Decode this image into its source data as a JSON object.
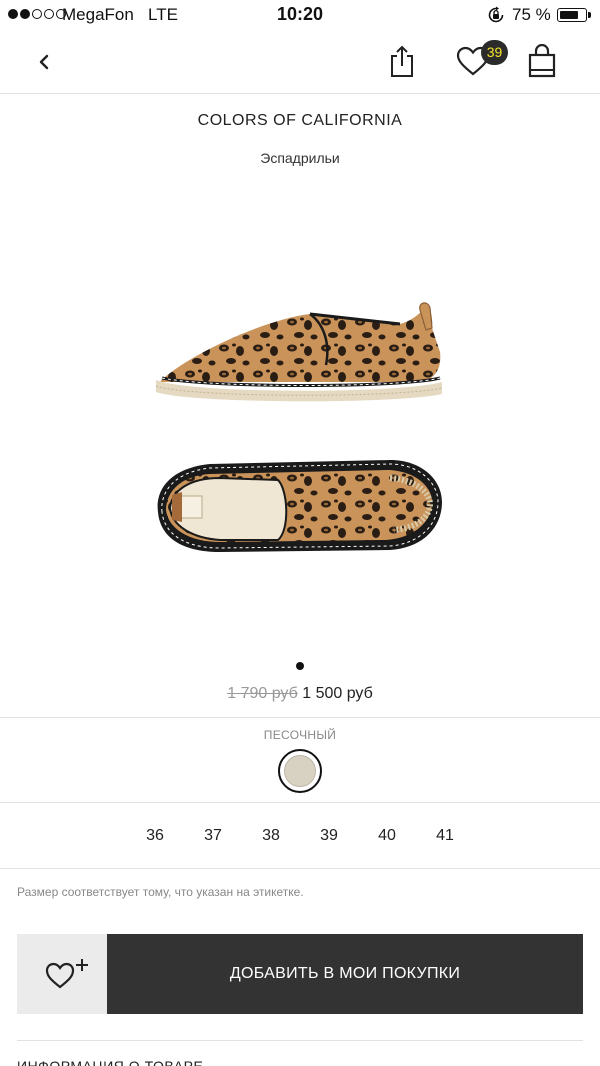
{
  "status_bar": {
    "carrier": "MegaFon",
    "network": "LTE",
    "time": "10:20",
    "battery": "75 %",
    "battery_level": 0.75,
    "signal_bars_filled": 2,
    "signal_bars_total": 5
  },
  "nav": {
    "wishlist_count": "39",
    "icons": [
      "chevron-left-icon",
      "share-icon",
      "heart-icon",
      "shopping-bag-icon"
    ]
  },
  "product": {
    "brand": "COLORS OF CALIFORNIA",
    "type": "Эспадрильи",
    "old_price": "1 790 руб",
    "price": "1 500 руб",
    "image_pages": 1,
    "current_page": 1
  },
  "color": {
    "name": "ПЕСОЧНЫЙ",
    "swatch": "#d8d2c3"
  },
  "sizes": [
    "36",
    "37",
    "38",
    "39",
    "40",
    "41"
  ],
  "size_note": "Размер соответствует тому, что указан на этикетке.",
  "actions": {
    "add_to_cart": "ДОБАВИТЬ В МОИ ПОКУПКИ",
    "add_to_favorites_icon": "heart-plus-icon"
  },
  "bottom_section": "ИНФОРМАЦИЯ О ТОВАРЕ"
}
